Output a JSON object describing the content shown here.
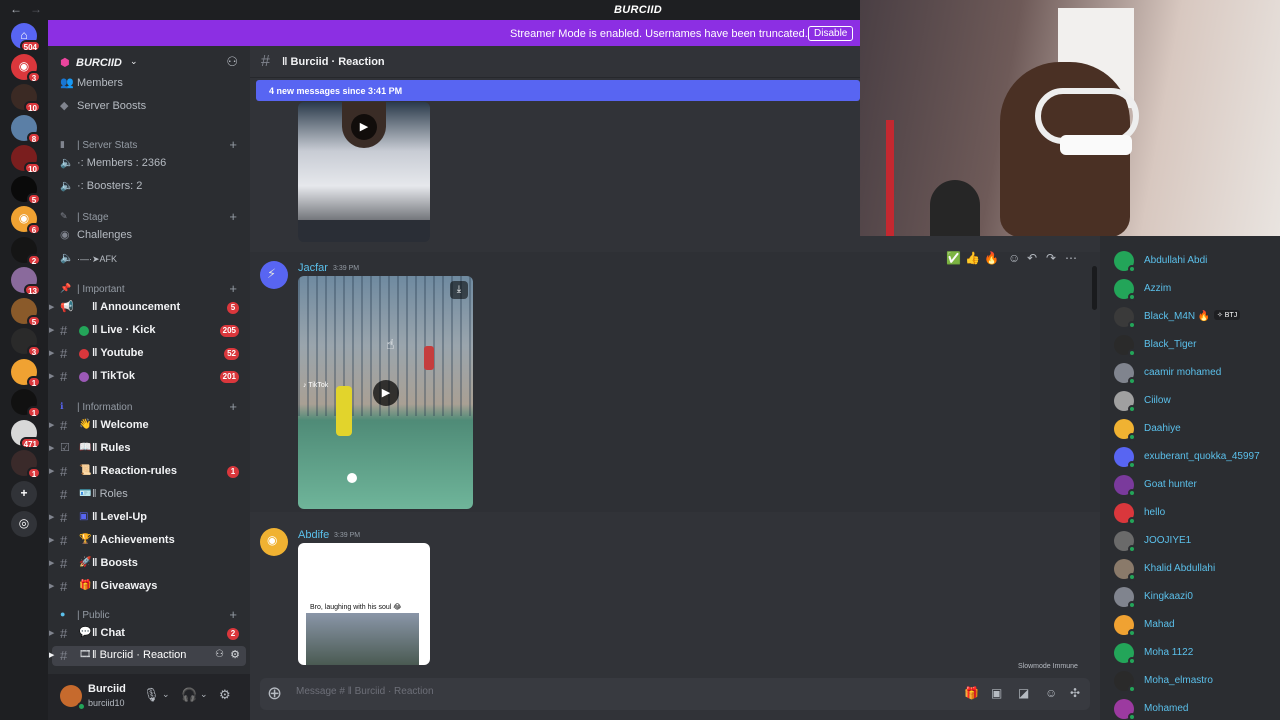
{
  "window": {
    "title": "BURCIID",
    "back": "←",
    "forward": "→"
  },
  "servers": [
    {
      "color": "#5865f2",
      "glyph": "⌂",
      "badge": "504"
    },
    {
      "color": "#da373c",
      "glyph": "◉",
      "badge": "3"
    },
    {
      "color": "#3b2a24",
      "glyph": "",
      "badge": "10"
    },
    {
      "color": "#5b7fa6",
      "glyph": "",
      "badge": "8"
    },
    {
      "color": "#7a1e1e",
      "glyph": "",
      "badge": "10"
    },
    {
      "color": "#0a0a0a",
      "glyph": "",
      "badge": "5"
    },
    {
      "color": "#f0a232",
      "glyph": "◉",
      "badge": "6"
    },
    {
      "color": "#151515",
      "glyph": "",
      "badge": "2"
    },
    {
      "color": "#8a6a9c",
      "glyph": "",
      "badge": "13"
    },
    {
      "color": "#8a5a2a",
      "glyph": "",
      "badge": "5"
    },
    {
      "color": "#2a2a2a",
      "glyph": "",
      "badge": "3"
    },
    {
      "color": "#f0a232",
      "glyph": "",
      "badge": "1"
    },
    {
      "color": "#111111",
      "glyph": "",
      "badge": "1"
    },
    {
      "color": "#d8d8d8",
      "glyph": "",
      "badge": "471"
    },
    {
      "color": "#3a2a2a",
      "glyph": "",
      "badge": "1"
    },
    {
      "color": "#313338",
      "glyph": "+",
      "badge": ""
    },
    {
      "color": "#313338",
      "glyph": "◎",
      "badge": ""
    }
  ],
  "banner": {
    "text": "Streamer Mode is enabled. Usernames have been truncated.",
    "button": "Disable"
  },
  "server": {
    "name": "BURCIID"
  },
  "sidebar": {
    "members": "Members",
    "boosts": "Server Boosts",
    "server_stats": "| Server Stats",
    "stat_members": "·: Members : 2366",
    "stat_boosters": "·: Boosters: 2",
    "stage": "| Stage",
    "challenges": "Challenges",
    "afk": "·—·➤AFK",
    "important": "| Important",
    "announcement": "ǁ Announcement",
    "announcement_badge": "5",
    "live": "ǁ Live · Kick",
    "live_badge": "205",
    "youtube": "ǁ Youtube",
    "youtube_badge": "52",
    "tiktok": "ǁ TikTok",
    "tiktok_badge": "201",
    "information": "| Information",
    "welcome": "ǁ Welcome",
    "rules": "ǁ Rules",
    "reaction_rules": "ǁ Reaction-rules",
    "reaction_rules_badge": "1",
    "roles": "ǁ Roles",
    "level_up": "ǁ Level-Up",
    "achievements": "ǁ Achievements",
    "boosts_ch": "ǁ Boosts",
    "giveaways": "ǁ Giveaways",
    "public": "| Public",
    "chat": "ǁ Chat",
    "chat_badge": "2",
    "burciid_reaction": "ǁ Burciid · Reaction"
  },
  "user": {
    "name": "Burciid",
    "tag": "burciid10"
  },
  "chat": {
    "channel": "ǁ Burciid · Reaction",
    "new_messages": "4 new messages since 3:41 PM",
    "messages": [
      {
        "author": "Jacfar",
        "time": "3:39 PM"
      },
      {
        "author": "Abdife",
        "time": "3:39 PM",
        "caption": "Bro, laughing with his soul 😂"
      }
    ],
    "video_watermark": "♪ TikTok",
    "composer_placeholder": "Message # ǁ Burciid · Reaction",
    "slowmode": "Slowmode Immune"
  },
  "members_list": [
    {
      "name": "Abdullahi Abdi",
      "color": "#23a559",
      "tag": ""
    },
    {
      "name": "Azzim",
      "color": "#23a559",
      "tag": ""
    },
    {
      "name": "Black_M4N 🔥",
      "color": "#3a3a3a",
      "tag": "✧ BTJ"
    },
    {
      "name": "Black_Tiger",
      "color": "#2a2a2a",
      "tag": ""
    },
    {
      "name": "caamir mohamed",
      "color": "#80848e",
      "tag": ""
    },
    {
      "name": "Ciilow",
      "color": "#a0a0a0",
      "tag": ""
    },
    {
      "name": "Daahiye",
      "color": "#f0b232",
      "tag": ""
    },
    {
      "name": "exuberant_quokka_45997",
      "color": "#5865f2",
      "tag": ""
    },
    {
      "name": "Goat hunter",
      "color": "#7a3a9c",
      "tag": ""
    },
    {
      "name": "hello",
      "color": "#da373c",
      "tag": ""
    },
    {
      "name": "JOOJIYE1",
      "color": "#6a6a6a",
      "tag": ""
    },
    {
      "name": "Khalid Abdullahi",
      "color": "#8a7a6a",
      "tag": ""
    },
    {
      "name": "Kingkaazi0",
      "color": "#80848e",
      "tag": ""
    },
    {
      "name": "Mahad",
      "color": "#f0a232",
      "tag": ""
    },
    {
      "name": "Moha 1122",
      "color": "#23a559",
      "tag": ""
    },
    {
      "name": "Moha_elmastro",
      "color": "#2a2a2a",
      "tag": ""
    },
    {
      "name": "Mohamed",
      "color": "#9c3aa0",
      "tag": ""
    }
  ]
}
